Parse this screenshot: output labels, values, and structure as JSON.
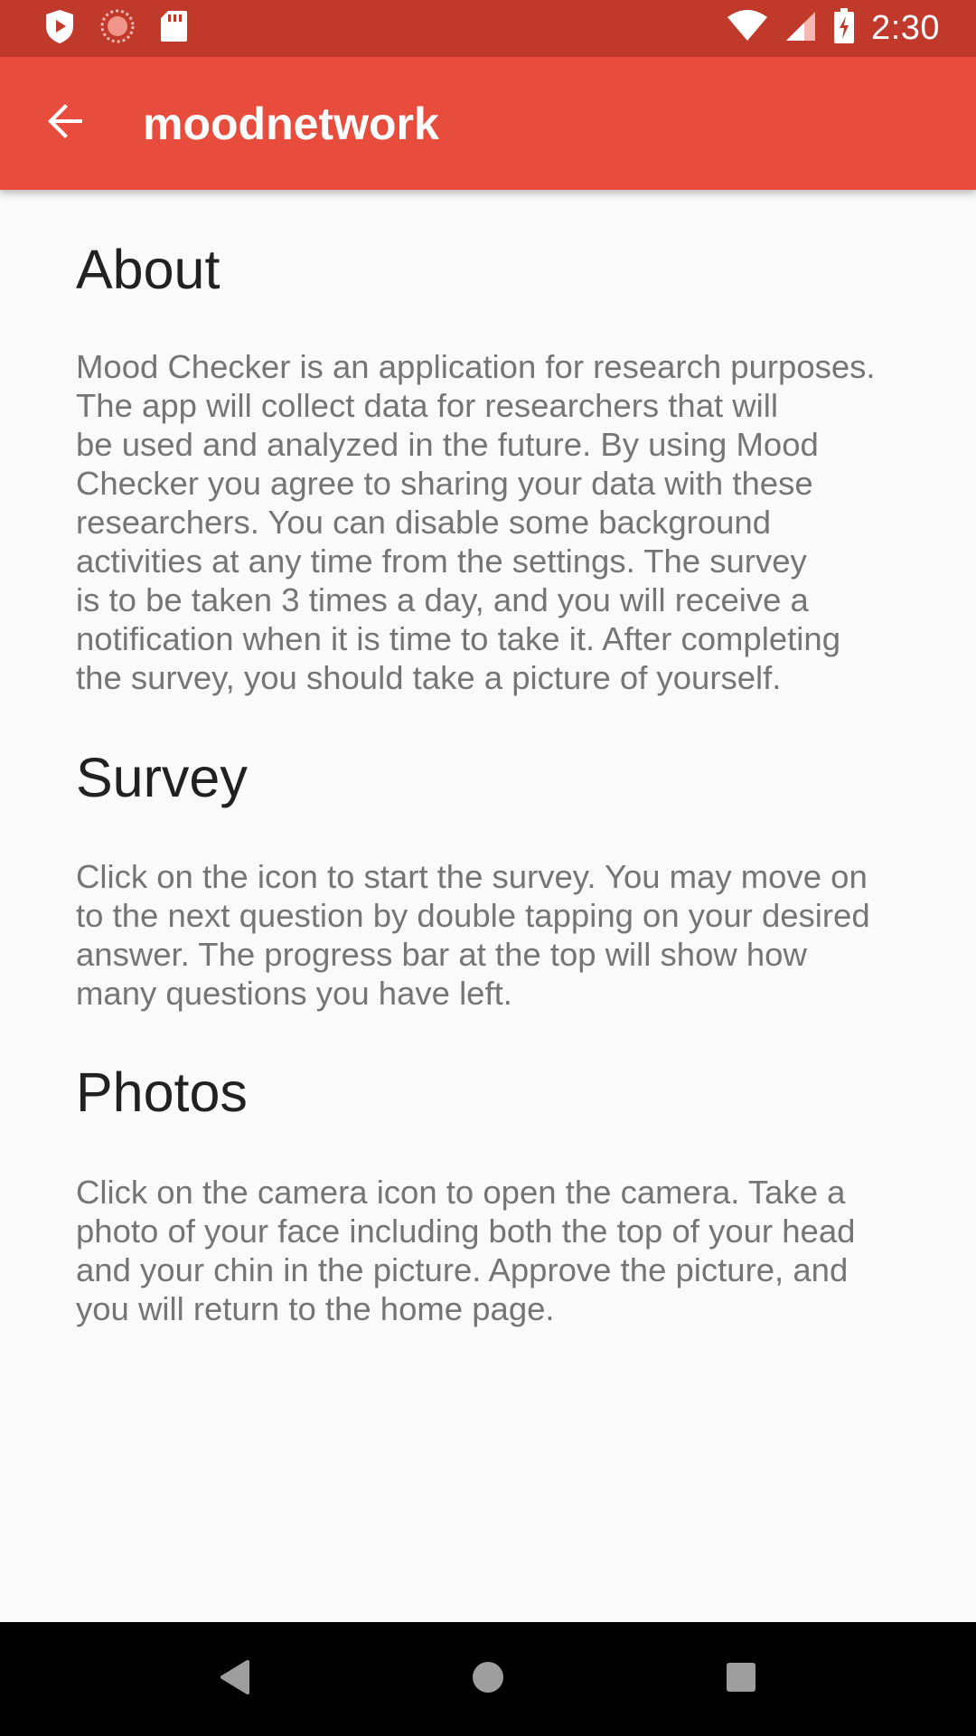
{
  "status_bar": {
    "time": "2:30",
    "left_icons": [
      "shield-play-icon",
      "loading-circle-icon",
      "sd-card-icon"
    ],
    "right_icons": [
      "wifi-icon",
      "cellular-signal-icon",
      "battery-charging-icon"
    ],
    "color": "#c0392b"
  },
  "app_bar": {
    "title": "moodnetwork",
    "back_icon": "arrow-back-icon",
    "color": "#e74c3c"
  },
  "sections": {
    "about": {
      "heading": "About",
      "lines": [
        "Mood Checker is an application for research purposes.",
        "The app will collect data for researchers that will",
        "be used and analyzed in the future. By using Mood",
        "Checker you agree to sharing your data with these",
        "researchers. You can disable some background",
        "activities at any time from the settings. The survey",
        "is to be taken 3 times a day, and you will receive a",
        "notification when it is time to take it. After completing",
        "the survey, you should take a picture of yourself."
      ]
    },
    "survey": {
      "heading": "Survey",
      "lines": [
        "Click on the icon to start the survey. You may move on",
        "to the next question by double tapping on your desired",
        "answer. The progress bar at the top will show how",
        "many questions you have left."
      ]
    },
    "photos": {
      "heading": "Photos",
      "lines": [
        "Click on the camera icon to open the camera. Take a",
        "photo of your face including both the top of your head",
        "and your chin in the picture. Approve the picture, and",
        "you will return to the home page."
      ]
    }
  },
  "nav_bar": {
    "buttons": [
      "back-triangle-icon",
      "home-circle-icon",
      "recents-square-icon"
    ]
  }
}
